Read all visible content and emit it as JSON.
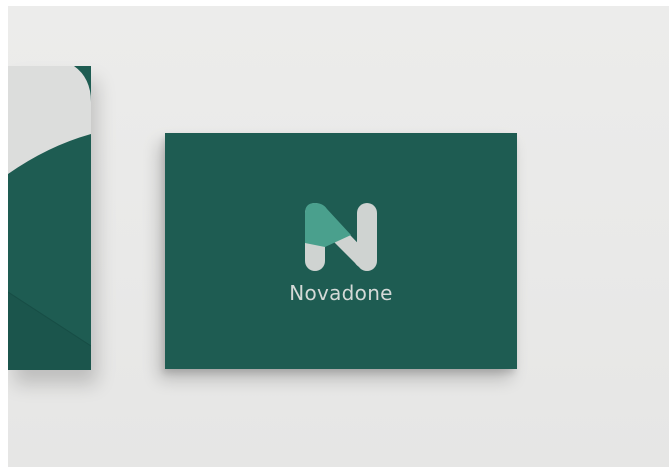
{
  "brand": {
    "name": "Novadone",
    "logo_icon": "n-letter-logo-icon"
  },
  "colors": {
    "card": "#1e5c52",
    "logo_accent": "#4aa08d",
    "logo_light": "#cfd3d1",
    "background": "#ebebea"
  }
}
